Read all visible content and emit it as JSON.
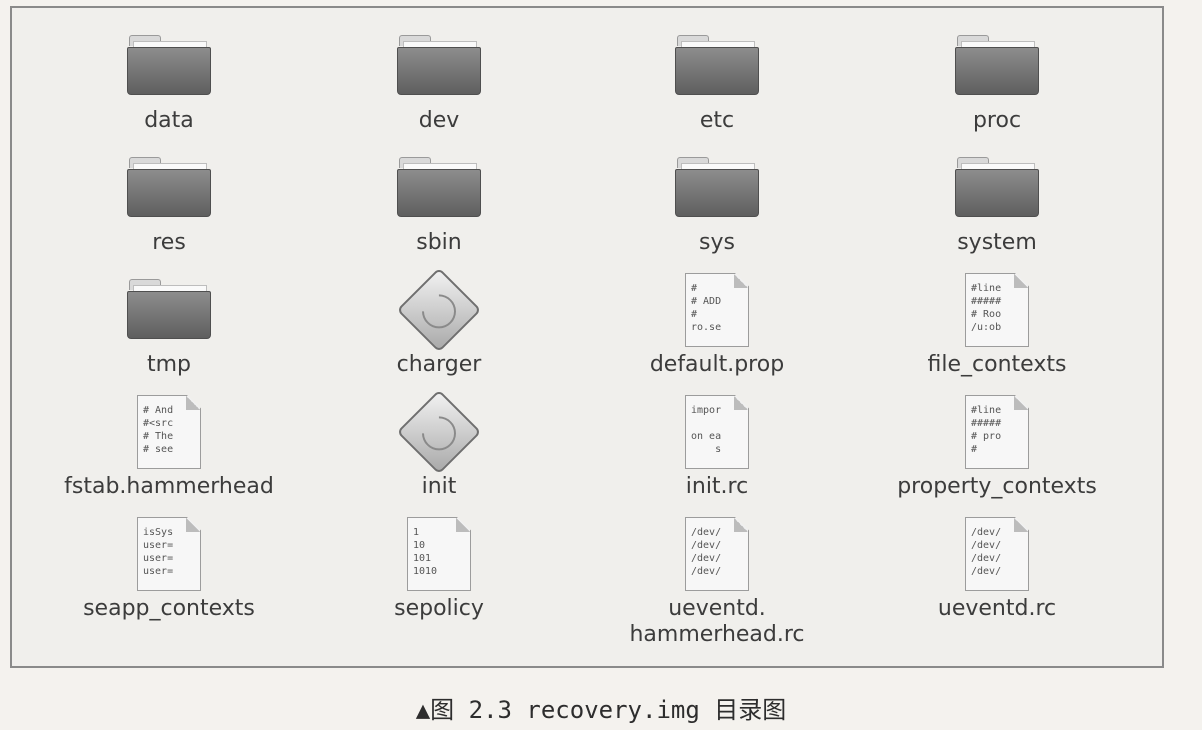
{
  "items": [
    {
      "label": "data",
      "kind": "folder"
    },
    {
      "label": "dev",
      "kind": "folder"
    },
    {
      "label": "etc",
      "kind": "folder"
    },
    {
      "label": "proc",
      "kind": "folder"
    },
    {
      "label": "res",
      "kind": "folder"
    },
    {
      "label": "sbin",
      "kind": "folder"
    },
    {
      "label": "sys",
      "kind": "folder"
    },
    {
      "label": "system",
      "kind": "folder"
    },
    {
      "label": "tmp",
      "kind": "folder"
    },
    {
      "label": "charger",
      "kind": "executable"
    },
    {
      "label": "default.prop",
      "kind": "text",
      "preview": "#\n# ADD\n#\nro.se"
    },
    {
      "label": "file_contexts",
      "kind": "text",
      "preview": "#line\n#####\n# Roo\n/u:ob"
    },
    {
      "label": "fstab.hammerhead",
      "kind": "text",
      "preview": "# And\n#<src\n# The\n# see"
    },
    {
      "label": "init",
      "kind": "executable"
    },
    {
      "label": "init.rc",
      "kind": "text",
      "preview": "impor\n\non ea\n    s"
    },
    {
      "label": "property_contexts",
      "kind": "text",
      "preview": "#line\n#####\n# pro\n#"
    },
    {
      "label": "seapp_contexts",
      "kind": "text",
      "preview": "isSys\nuser=\nuser=\nuser="
    },
    {
      "label": "sepolicy",
      "kind": "binary",
      "preview": "1\n10\n101\n1010"
    },
    {
      "label": "ueventd.\nhammerhead.rc",
      "kind": "text",
      "preview": "/dev/\n/dev/\n/dev/\n/dev/"
    },
    {
      "label": "ueventd.rc",
      "kind": "text",
      "preview": "/dev/\n/dev/\n/dev/\n/dev/"
    }
  ],
  "caption": "▲图 2.3   recovery.img 目录图"
}
